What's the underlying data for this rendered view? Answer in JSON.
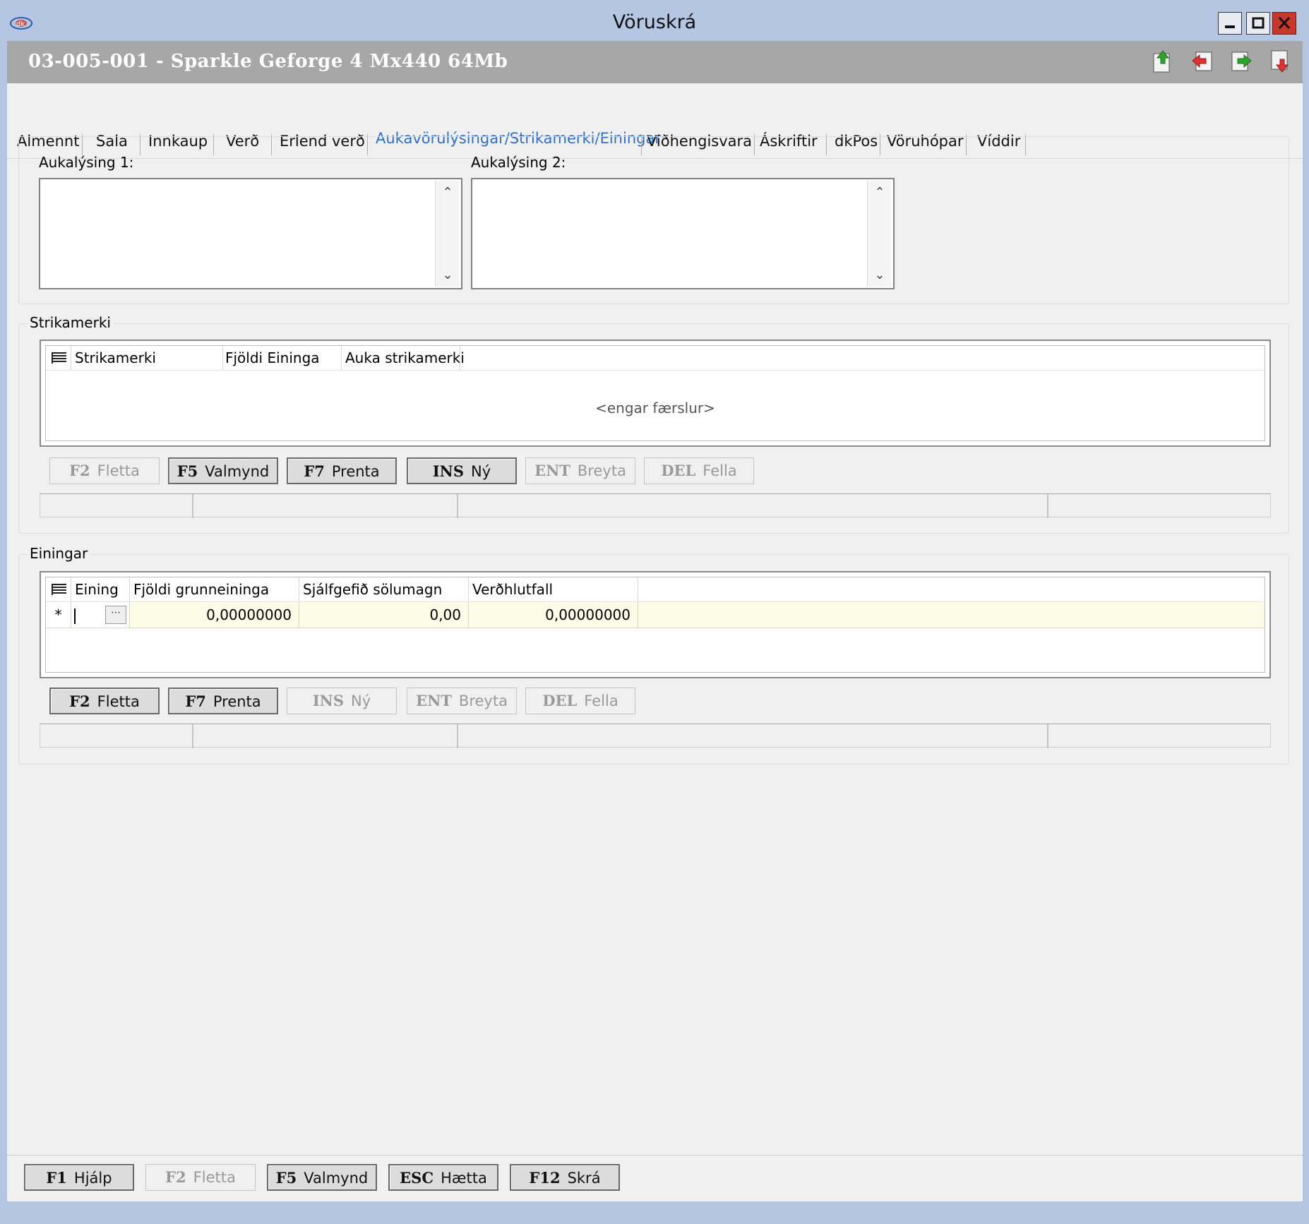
{
  "window": {
    "title": "Vöruskrá",
    "controls": [
      "minimize-icon",
      "maximize-icon",
      "close-icon"
    ]
  },
  "header": {
    "title": "03-005-001 - Sparkle Geforge 4 Mx440  64Mb",
    "icons": [
      "record-upload-icon",
      "record-back-icon",
      "record-forward-icon",
      "record-delete-icon"
    ]
  },
  "tabs": [
    {
      "label": "Almennt"
    },
    {
      "label": "Sala"
    },
    {
      "label": "Innkaup"
    },
    {
      "label": "Verð"
    },
    {
      "label": "Erlend verð"
    },
    {
      "label": "Aukavörulýsingar/Strikamerki/Einingar",
      "active": true
    },
    {
      "label": "Viðhengisvara"
    },
    {
      "label": "Áskriftir"
    },
    {
      "label": "dkPos"
    },
    {
      "label": "Vöruhópar"
    },
    {
      "label": "Víddir"
    }
  ],
  "descriptions": {
    "label1": "Aukalýsing 1:",
    "value1": "",
    "label2": "Aukalýsing 2:",
    "value2": ""
  },
  "barcodes": {
    "group_label": "Strikamerki",
    "columns": [
      "Strikamerki",
      "Fjöldi Eininga",
      "Auka strikamerki"
    ],
    "empty_text": "<engar færslur>",
    "buttons": [
      {
        "key": "F2",
        "label": "Fletta",
        "enabled": false
      },
      {
        "key": "F5",
        "label": "Valmynd",
        "enabled": true
      },
      {
        "key": "F7",
        "label": "Prenta",
        "enabled": true
      },
      {
        "key": "INS",
        "label": "Ný",
        "enabled": true
      },
      {
        "key": "ENT",
        "label": "Breyta",
        "enabled": false
      },
      {
        "key": "DEL",
        "label": "Fella",
        "enabled": false
      }
    ]
  },
  "units": {
    "group_label": "Einingar",
    "columns": [
      "Eining",
      "Fjöldi grunneininga",
      "Sjálfgefið sölumagn",
      "Verðhlutfall"
    ],
    "new_row": {
      "marker": "*",
      "unit": "",
      "base_units": "0,00000000",
      "default_qty": "0,00",
      "price_ratio": "0,00000000"
    },
    "buttons": [
      {
        "key": "F2",
        "label": "Fletta",
        "enabled": true
      },
      {
        "key": "F7",
        "label": "Prenta",
        "enabled": true
      },
      {
        "key": "INS",
        "label": "Ný",
        "enabled": false
      },
      {
        "key": "ENT",
        "label": "Breyta",
        "enabled": false
      },
      {
        "key": "DEL",
        "label": "Fella",
        "enabled": false
      }
    ]
  },
  "footer": {
    "buttons": [
      {
        "key": "F1",
        "label": "Hjálp",
        "enabled": true
      },
      {
        "key": "F2",
        "label": "Fletta",
        "enabled": false
      },
      {
        "key": "F5",
        "label": "Valmynd",
        "enabled": true
      },
      {
        "key": "ESC",
        "label": "Hætta",
        "enabled": true
      },
      {
        "key": "F12",
        "label": "Skrá",
        "enabled": true
      }
    ]
  },
  "colors": {
    "titlebar": "#b4c6e2",
    "header": "#a7a7a7",
    "active_tab": "#2f6fc0",
    "new_row": "#fbfbe6",
    "close_button": "#c7382b"
  }
}
